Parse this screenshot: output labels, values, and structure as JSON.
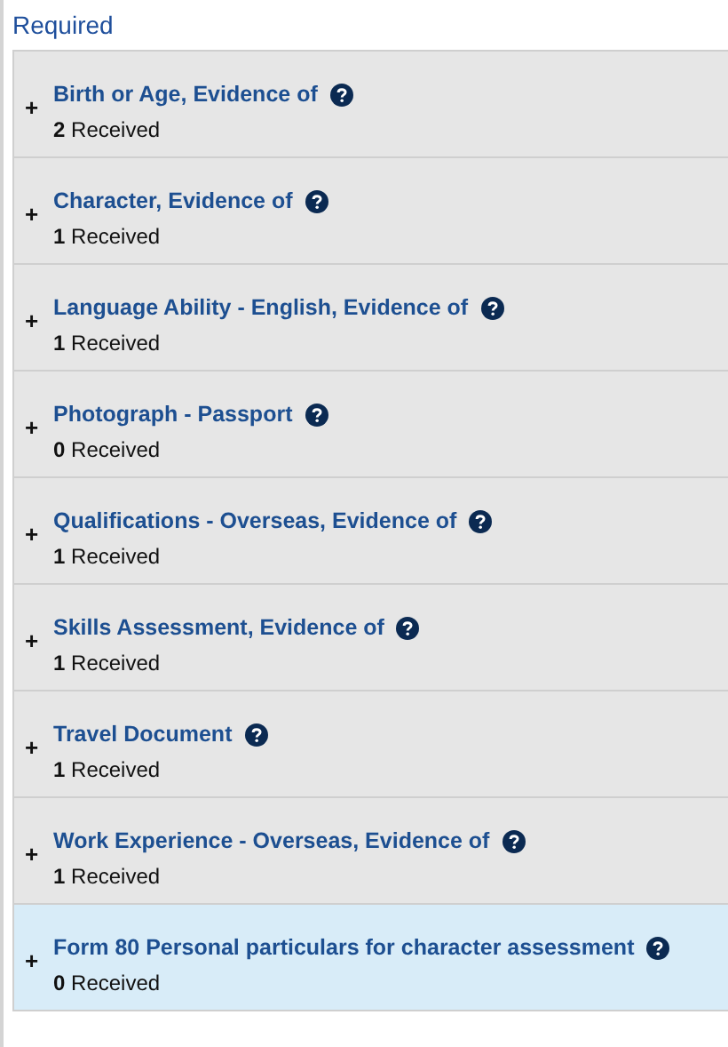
{
  "section_title": "Required",
  "items": [
    {
      "toggle": "+",
      "title": "Birth or Age, Evidence of",
      "received": "**2** Received",
      "selected": false
    },
    {
      "toggle": "+",
      "title": "Character, Evidence of",
      "received": "**1** Received",
      "selected": false
    },
    {
      "toggle": "+",
      "title": "Language Ability - English, Evidence of",
      "received": "**1** Received",
      "selected": false
    },
    {
      "toggle": "+",
      "title": "Photograph - Passport",
      "received": "**0** Received",
      "selected": false
    },
    {
      "toggle": "+",
      "title": "Qualifications - Overseas, Evidence of",
      "received": "**1** Received",
      "selected": false
    },
    {
      "toggle": "+",
      "title": "Skills Assessment, Evidence of",
      "received": "**1** Received",
      "selected": false
    },
    {
      "toggle": "+",
      "title": "Travel Document",
      "received": "**1** Received",
      "selected": false
    },
    {
      "toggle": "+",
      "title": "Work Experience - Overseas, Evidence of",
      "received": "**1** Received",
      "selected": false
    },
    {
      "toggle": "+",
      "title": "Form 80 Personal particulars for character assessment",
      "received": "**0** Received",
      "selected": true
    }
  ]
}
